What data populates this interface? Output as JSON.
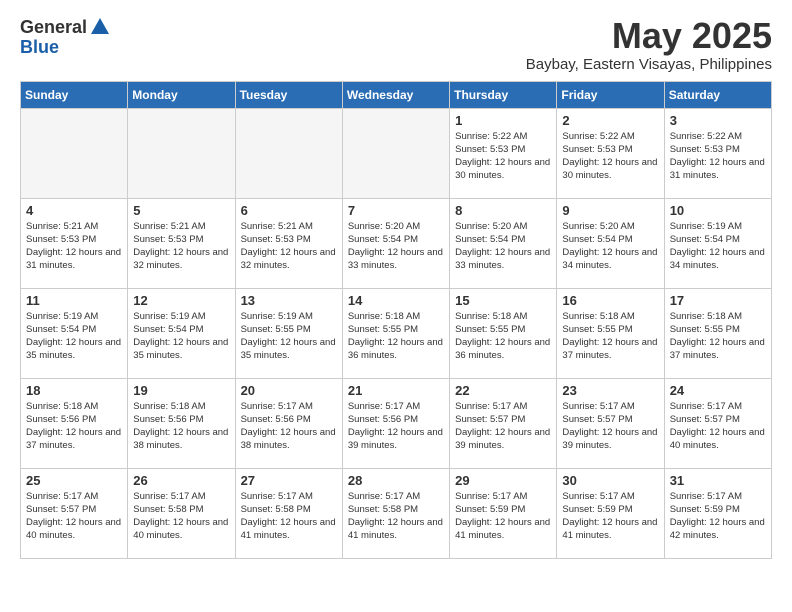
{
  "header": {
    "logo_general": "General",
    "logo_blue": "Blue",
    "month_title": "May 2025",
    "location": "Baybay, Eastern Visayas, Philippines"
  },
  "weekdays": [
    "Sunday",
    "Monday",
    "Tuesday",
    "Wednesday",
    "Thursday",
    "Friday",
    "Saturday"
  ],
  "weeks": [
    [
      {
        "day": "",
        "empty": true
      },
      {
        "day": "",
        "empty": true
      },
      {
        "day": "",
        "empty": true
      },
      {
        "day": "",
        "empty": true
      },
      {
        "day": "1",
        "sunrise": "5:22 AM",
        "sunset": "5:53 PM",
        "daylight": "12 hours and 30 minutes."
      },
      {
        "day": "2",
        "sunrise": "5:22 AM",
        "sunset": "5:53 PM",
        "daylight": "12 hours and 30 minutes."
      },
      {
        "day": "3",
        "sunrise": "5:22 AM",
        "sunset": "5:53 PM",
        "daylight": "12 hours and 31 minutes."
      }
    ],
    [
      {
        "day": "4",
        "sunrise": "5:21 AM",
        "sunset": "5:53 PM",
        "daylight": "12 hours and 31 minutes."
      },
      {
        "day": "5",
        "sunrise": "5:21 AM",
        "sunset": "5:53 PM",
        "daylight": "12 hours and 32 minutes."
      },
      {
        "day": "6",
        "sunrise": "5:21 AM",
        "sunset": "5:53 PM",
        "daylight": "12 hours and 32 minutes."
      },
      {
        "day": "7",
        "sunrise": "5:20 AM",
        "sunset": "5:54 PM",
        "daylight": "12 hours and 33 minutes."
      },
      {
        "day": "8",
        "sunrise": "5:20 AM",
        "sunset": "5:54 PM",
        "daylight": "12 hours and 33 minutes."
      },
      {
        "day": "9",
        "sunrise": "5:20 AM",
        "sunset": "5:54 PM",
        "daylight": "12 hours and 34 minutes."
      },
      {
        "day": "10",
        "sunrise": "5:19 AM",
        "sunset": "5:54 PM",
        "daylight": "12 hours and 34 minutes."
      }
    ],
    [
      {
        "day": "11",
        "sunrise": "5:19 AM",
        "sunset": "5:54 PM",
        "daylight": "12 hours and 35 minutes."
      },
      {
        "day": "12",
        "sunrise": "5:19 AM",
        "sunset": "5:54 PM",
        "daylight": "12 hours and 35 minutes."
      },
      {
        "day": "13",
        "sunrise": "5:19 AM",
        "sunset": "5:55 PM",
        "daylight": "12 hours and 35 minutes."
      },
      {
        "day": "14",
        "sunrise": "5:18 AM",
        "sunset": "5:55 PM",
        "daylight": "12 hours and 36 minutes."
      },
      {
        "day": "15",
        "sunrise": "5:18 AM",
        "sunset": "5:55 PM",
        "daylight": "12 hours and 36 minutes."
      },
      {
        "day": "16",
        "sunrise": "5:18 AM",
        "sunset": "5:55 PM",
        "daylight": "12 hours and 37 minutes."
      },
      {
        "day": "17",
        "sunrise": "5:18 AM",
        "sunset": "5:55 PM",
        "daylight": "12 hours and 37 minutes."
      }
    ],
    [
      {
        "day": "18",
        "sunrise": "5:18 AM",
        "sunset": "5:56 PM",
        "daylight": "12 hours and 37 minutes."
      },
      {
        "day": "19",
        "sunrise": "5:18 AM",
        "sunset": "5:56 PM",
        "daylight": "12 hours and 38 minutes."
      },
      {
        "day": "20",
        "sunrise": "5:17 AM",
        "sunset": "5:56 PM",
        "daylight": "12 hours and 38 minutes."
      },
      {
        "day": "21",
        "sunrise": "5:17 AM",
        "sunset": "5:56 PM",
        "daylight": "12 hours and 39 minutes."
      },
      {
        "day": "22",
        "sunrise": "5:17 AM",
        "sunset": "5:57 PM",
        "daylight": "12 hours and 39 minutes."
      },
      {
        "day": "23",
        "sunrise": "5:17 AM",
        "sunset": "5:57 PM",
        "daylight": "12 hours and 39 minutes."
      },
      {
        "day": "24",
        "sunrise": "5:17 AM",
        "sunset": "5:57 PM",
        "daylight": "12 hours and 40 minutes."
      }
    ],
    [
      {
        "day": "25",
        "sunrise": "5:17 AM",
        "sunset": "5:57 PM",
        "daylight": "12 hours and 40 minutes."
      },
      {
        "day": "26",
        "sunrise": "5:17 AM",
        "sunset": "5:58 PM",
        "daylight": "12 hours and 40 minutes."
      },
      {
        "day": "27",
        "sunrise": "5:17 AM",
        "sunset": "5:58 PM",
        "daylight": "12 hours and 41 minutes."
      },
      {
        "day": "28",
        "sunrise": "5:17 AM",
        "sunset": "5:58 PM",
        "daylight": "12 hours and 41 minutes."
      },
      {
        "day": "29",
        "sunrise": "5:17 AM",
        "sunset": "5:59 PM",
        "daylight": "12 hours and 41 minutes."
      },
      {
        "day": "30",
        "sunrise": "5:17 AM",
        "sunset": "5:59 PM",
        "daylight": "12 hours and 41 minutes."
      },
      {
        "day": "31",
        "sunrise": "5:17 AM",
        "sunset": "5:59 PM",
        "daylight": "12 hours and 42 minutes."
      }
    ]
  ]
}
